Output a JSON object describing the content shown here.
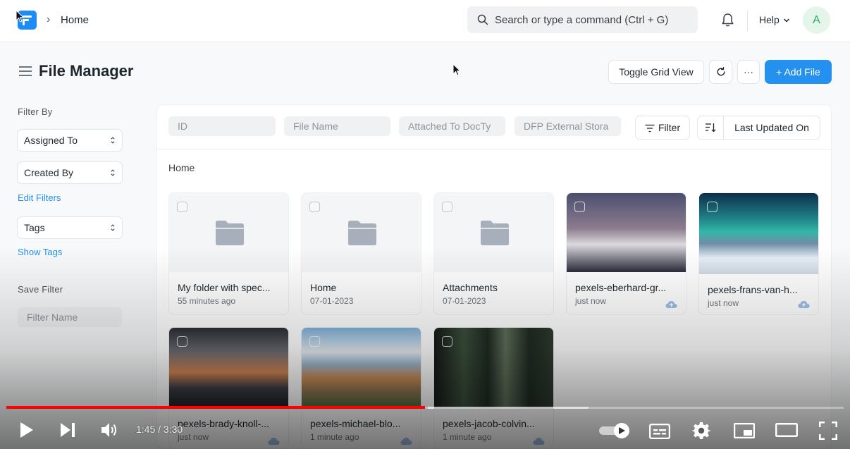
{
  "app": {
    "breadcrumb_sep": "›",
    "breadcrumb": "Home",
    "search_placeholder": "Search or type a command (Ctrl + G)",
    "help_label": "Help",
    "avatar_initial": "A"
  },
  "page": {
    "title": "File Manager",
    "toggle_grid_label": "Toggle Grid View",
    "more_label": "···",
    "add_file_label": "+ Add File"
  },
  "sidebar": {
    "filter_by_label": "Filter By",
    "assigned_to_label": "Assigned To",
    "created_by_label": "Created By",
    "edit_filters_label": "Edit Filters",
    "tags_label": "Tags",
    "show_tags_label": "Show Tags",
    "save_filter_label": "Save Filter",
    "filter_name_placeholder": "Filter Name"
  },
  "filters": {
    "id_placeholder": "ID",
    "file_name_placeholder": "File Name",
    "attached_to_placeholder": "Attached To DocTy",
    "dfp_placeholder": "DFP External Stora",
    "filter_button_label": "Filter",
    "sort_by_label": "Last Updated On"
  },
  "grid": {
    "breadcrumb": "Home",
    "files": [
      {
        "name": "My folder with spec...",
        "meta": "55 minutes ago",
        "kind": "folder"
      },
      {
        "name": "Home",
        "meta": "07-01-2023",
        "kind": "folder"
      },
      {
        "name": "Attachments",
        "meta": "07-01-2023",
        "kind": "folder"
      },
      {
        "name": "pexels-eberhard-gr...",
        "meta": "just now",
        "kind": "image",
        "thumb_colors": [
          "#4c4f6e",
          "#a48f92",
          "#dcd9df",
          "#2a2c3b"
        ]
      },
      {
        "name": "pexels-frans-van-h...",
        "meta": "just now",
        "kind": "image",
        "thumb_colors": [
          "#0c2f4a",
          "#33b6a7",
          "#e6eef5",
          "#6f8ca6"
        ]
      },
      {
        "name": "pexels-brady-knoll-...",
        "meta": "just now",
        "kind": "image",
        "thumb_colors": [
          "#2b2f36",
          "#d48553",
          "#6d6d73",
          "#1a1d22"
        ]
      },
      {
        "name": "pexels-michael-blo...",
        "meta": "1 minute ago",
        "kind": "image",
        "thumb_colors": [
          "#7fb1d9",
          "#e9eef3",
          "#c88b53",
          "#3f6b3a"
        ]
      },
      {
        "name": "pexels-jacob-colvin...",
        "meta": "1 minute ago",
        "kind": "image",
        "thumb_colors": [
          "#1f2a22",
          "#3b4f3c",
          "#5f6f5a",
          "#151a16"
        ]
      }
    ]
  },
  "video": {
    "time_label": "1:45 / 3:30",
    "progress": 0.5
  },
  "colors": {
    "accent": "#2490ef",
    "progress": "#ff0000"
  }
}
